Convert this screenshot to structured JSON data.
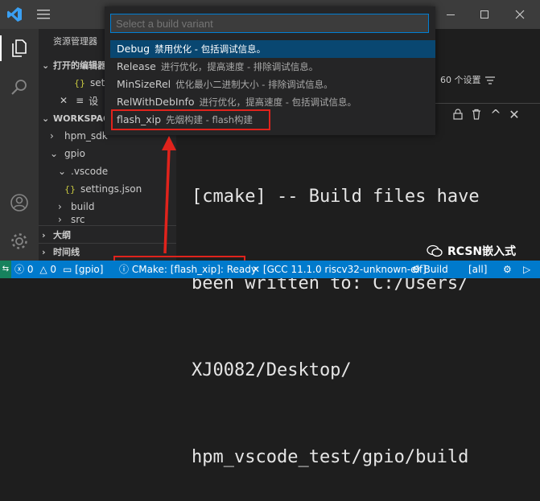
{
  "quick_pick": {
    "placeholder": "Select a build variant",
    "items": [
      {
        "label": "Debug",
        "description": "禁用优化 - 包括调试信息。"
      },
      {
        "label": "Release",
        "description": "进行优化，提高速度 - 排除调试信息。"
      },
      {
        "label": "MinSizeRel",
        "description": "优化最小二进制大小 - 排除调试信息。"
      },
      {
        "label": "RelWithDebInfo",
        "description": "进行优化，提高速度 - 包括调试信息。"
      },
      {
        "label": "flash_xip",
        "description": "先烟构建 - flash构建"
      }
    ]
  },
  "sidebar": {
    "title": "资源管理器",
    "open_editors": "打开的编辑器",
    "open_files": [
      "set",
      "设"
    ],
    "workspace": "WORKSPACE",
    "tree": [
      "hpm_sdk",
      "gpio",
      ".vscode",
      "settings.json",
      "build",
      "src"
    ],
    "outline": "大纲",
    "timeline": "时间线"
  },
  "editor": {
    "settings_count": "60 个设置"
  },
  "terminal": {
    "lines": [
      "[cmake] -- Build files have",
      "been written to: C:/Users/",
      "XJ0082/Desktop/",
      "hpm_vscode_test/gpio/build"
    ]
  },
  "statusbar": {
    "errors": "0",
    "warnings": "0",
    "folder": "[gpio]",
    "cmake": "CMake: [flash_xip]: Ready",
    "kit": "[GCC 11.1.0 riscv32-unknown-elf]",
    "build": "Build",
    "target": "[all]"
  },
  "watermark": "RCSN嵌入式",
  "colors": {
    "accent": "#007acc",
    "highlight_box": "#e0231c",
    "selection": "#094771"
  }
}
